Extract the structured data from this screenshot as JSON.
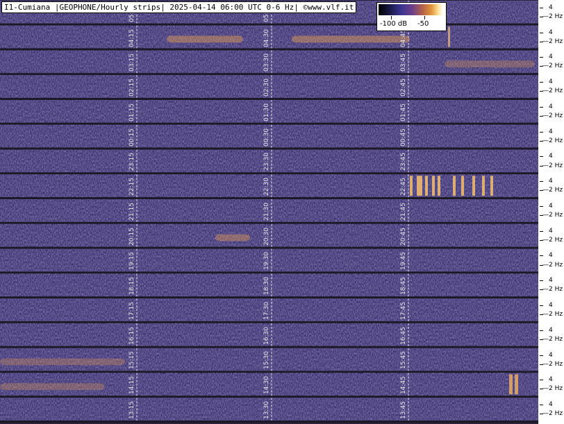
{
  "title": "I1-Cumiana |GEOPHONE/Hourly strips| 2025-04-14 06:00 UTC 0-6 Hz| ©www.vlf.it",
  "colorbar": {
    "labels": [
      "-100 dB",
      "-50"
    ],
    "colors": [
      "#000000",
      "#3a3490",
      "#b46248",
      "#e2963a",
      "#ffffff"
    ]
  },
  "chart_data": {
    "type": "heatmap",
    "title": "I1-Cumiana |GEOPHONE/Hourly strips| 2025-04-14 06:00 UTC 0-6 Hz| ©www.vlf.it",
    "xlabel": "",
    "ylabel": "",
    "frequency_range_hz": [
      0,
      6
    ],
    "freq_tick_labels": [
      "4",
      "2 Hz"
    ],
    "colorbar_range_db": [
      -100,
      -50
    ],
    "colorbar_tick_labels": [
      "-100 dB",
      "-50"
    ],
    "strips": [
      {
        "labels": [
          "05:15",
          "05:30",
          "05:45"
        ]
      },
      {
        "labels": [
          "04:15",
          "04:30",
          "04:45"
        ]
      },
      {
        "labels": [
          "03:15",
          "03:30",
          "03:45"
        ]
      },
      {
        "labels": [
          "02:15",
          "02:30",
          "02:45"
        ]
      },
      {
        "labels": [
          "01:15",
          "01:30",
          "01:45"
        ]
      },
      {
        "labels": [
          "00:15",
          "00:30",
          "00:45"
        ]
      },
      {
        "labels": [
          "23:15",
          "23:30",
          "23:45"
        ]
      },
      {
        "labels": [
          "22:15",
          "22:30",
          "22:45"
        ]
      },
      {
        "labels": [
          "21:15",
          "21:30",
          "21:45"
        ]
      },
      {
        "labels": [
          "20:15",
          "20:30",
          "20:45"
        ]
      },
      {
        "labels": [
          "19:15",
          "19:30",
          "19:45"
        ]
      },
      {
        "labels": [
          "18:15",
          "18:30",
          "18:45"
        ]
      },
      {
        "labels": [
          "17:15",
          "17:30",
          "17:45"
        ]
      },
      {
        "labels": [
          "16:15",
          "16:30",
          "16:45"
        ]
      },
      {
        "labels": [
          "15:15",
          "15:30",
          "15:45"
        ]
      },
      {
        "labels": [
          "14:15",
          "14:30",
          "14:45"
        ]
      },
      {
        "labels": [
          "13:15",
          "13:30",
          "13:45"
        ]
      }
    ]
  }
}
